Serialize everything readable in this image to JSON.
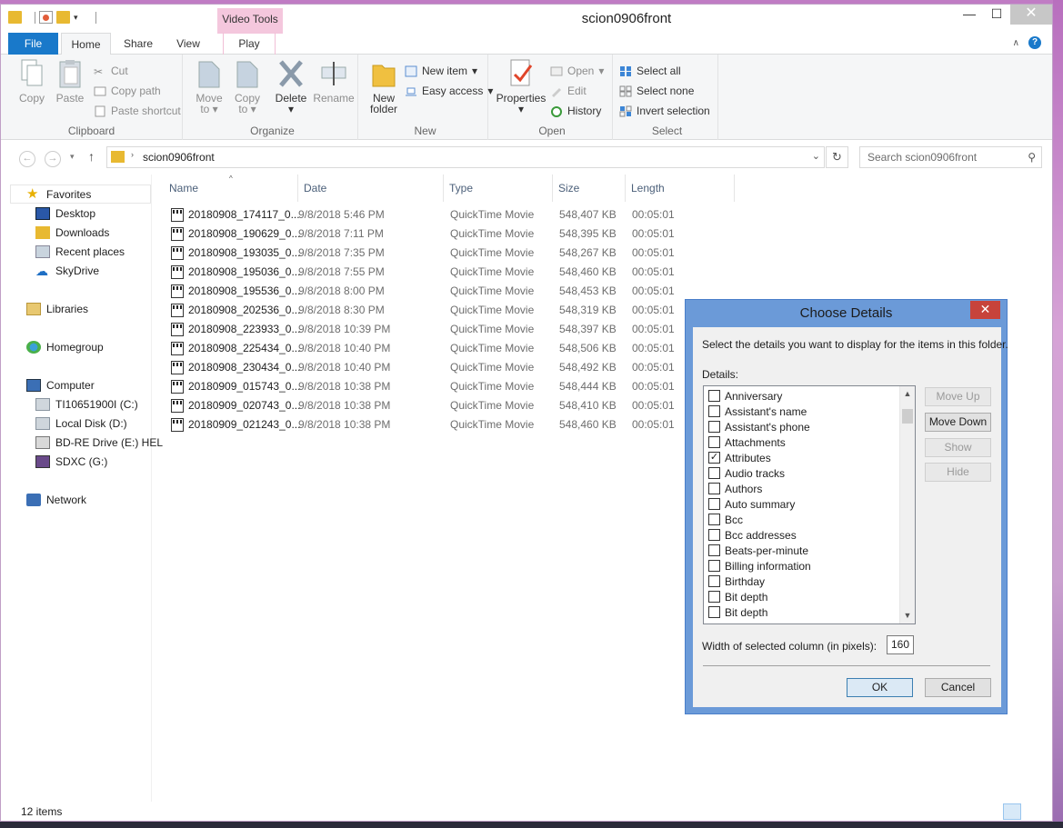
{
  "window": {
    "title": "scion0906front",
    "context_tab_group": "Video Tools",
    "minimize": "—",
    "maximize": "☐",
    "close": "✕"
  },
  "tabs": {
    "file": "File",
    "home": "Home",
    "share": "Share",
    "view": "View",
    "play": "Play"
  },
  "ribbon": {
    "clipboard": {
      "label": "Clipboard",
      "copy": "Copy",
      "paste": "Paste",
      "cut": "Cut",
      "copy_path": "Copy path",
      "paste_shortcut": "Paste shortcut"
    },
    "organize": {
      "label": "Organize",
      "move_to": "Move",
      "move_to_2": "to",
      "copy_to": "Copy",
      "copy_to_2": "to",
      "delete": "Delete",
      "rename": "Rename"
    },
    "new": {
      "label": "New",
      "new_folder": "New",
      "new_folder_2": "folder",
      "new_item": "New item",
      "easy_access": "Easy access"
    },
    "open": {
      "label": "Open",
      "properties": "Properties",
      "open": "Open",
      "edit": "Edit",
      "history": "History"
    },
    "select": {
      "label": "Select",
      "select_all": "Select all",
      "select_none": "Select none",
      "invert": "Invert selection"
    }
  },
  "address": {
    "path": "scion0906front",
    "search_placeholder": "Search scion0906front"
  },
  "nav": {
    "favorites": "Favorites",
    "desktop": "Desktop",
    "downloads": "Downloads",
    "recent": "Recent places",
    "skydrive": "SkyDrive",
    "libraries": "Libraries",
    "homegroup": "Homegroup",
    "computer": "Computer",
    "drive_c": "TI10651900I (C:)",
    "drive_d": "Local Disk (D:)",
    "drive_e": "BD-RE Drive (E:) HEL",
    "drive_g": "SDXC (G:)",
    "network": "Network"
  },
  "columns": {
    "name": "Name",
    "date": "Date",
    "type": "Type",
    "size": "Size",
    "length": "Length"
  },
  "files": [
    {
      "name": "20180908_174117_0...",
      "date": "9/8/2018 5:46 PM",
      "type": "QuickTime Movie",
      "size": "548,407 KB",
      "length": "00:05:01"
    },
    {
      "name": "20180908_190629_0...",
      "date": "9/8/2018 7:11 PM",
      "type": "QuickTime Movie",
      "size": "548,395 KB",
      "length": "00:05:01"
    },
    {
      "name": "20180908_193035_0...",
      "date": "9/8/2018 7:35 PM",
      "type": "QuickTime Movie",
      "size": "548,267 KB",
      "length": "00:05:01"
    },
    {
      "name": "20180908_195036_0...",
      "date": "9/8/2018 7:55 PM",
      "type": "QuickTime Movie",
      "size": "548,460 KB",
      "length": "00:05:01"
    },
    {
      "name": "20180908_195536_0...",
      "date": "9/8/2018 8:00 PM",
      "type": "QuickTime Movie",
      "size": "548,453 KB",
      "length": "00:05:01"
    },
    {
      "name": "20180908_202536_0...",
      "date": "9/8/2018 8:30 PM",
      "type": "QuickTime Movie",
      "size": "548,319 KB",
      "length": "00:05:01"
    },
    {
      "name": "20180908_223933_0...",
      "date": "9/8/2018 10:39 PM",
      "type": "QuickTime Movie",
      "size": "548,397 KB",
      "length": "00:05:01"
    },
    {
      "name": "20180908_225434_0...",
      "date": "9/8/2018 10:40 PM",
      "type": "QuickTime Movie",
      "size": "548,506 KB",
      "length": "00:05:01"
    },
    {
      "name": "20180908_230434_0...",
      "date": "9/8/2018 10:40 PM",
      "type": "QuickTime Movie",
      "size": "548,492 KB",
      "length": "00:05:01"
    },
    {
      "name": "20180909_015743_0...",
      "date": "9/8/2018 10:38 PM",
      "type": "QuickTime Movie",
      "size": "548,444 KB",
      "length": "00:05:01"
    },
    {
      "name": "20180909_020743_0...",
      "date": "9/8/2018 10:38 PM",
      "type": "QuickTime Movie",
      "size": "548,410 KB",
      "length": "00:05:01"
    },
    {
      "name": "20180909_021243_0...",
      "date": "9/8/2018 10:38 PM",
      "type": "QuickTime Movie",
      "size": "548,460 KB",
      "length": "00:05:01"
    }
  ],
  "status": {
    "count": "12 items"
  },
  "dialog": {
    "title": "Choose Details",
    "instruction": "Select the details you want to display for the items in this folder.",
    "details_label": "Details:",
    "items": [
      {
        "label": "Anniversary",
        "checked": false
      },
      {
        "label": "Assistant's name",
        "checked": false
      },
      {
        "label": "Assistant's phone",
        "checked": false
      },
      {
        "label": "Attachments",
        "checked": false
      },
      {
        "label": "Attributes",
        "checked": true
      },
      {
        "label": "Audio tracks",
        "checked": false
      },
      {
        "label": "Authors",
        "checked": false
      },
      {
        "label": "Auto summary",
        "checked": false
      },
      {
        "label": "Bcc",
        "checked": false
      },
      {
        "label": "Bcc addresses",
        "checked": false
      },
      {
        "label": "Beats-per-minute",
        "checked": false
      },
      {
        "label": "Billing information",
        "checked": false
      },
      {
        "label": "Birthday",
        "checked": false
      },
      {
        "label": "Bit depth",
        "checked": false
      },
      {
        "label": "Bit depth",
        "checked": false
      }
    ],
    "move_up": "Move Up",
    "move_down": "Move Down",
    "show": "Show",
    "hide": "Hide",
    "width_label": "Width of selected column (in pixels):",
    "width_value": "160",
    "ok": "OK",
    "cancel": "Cancel"
  }
}
